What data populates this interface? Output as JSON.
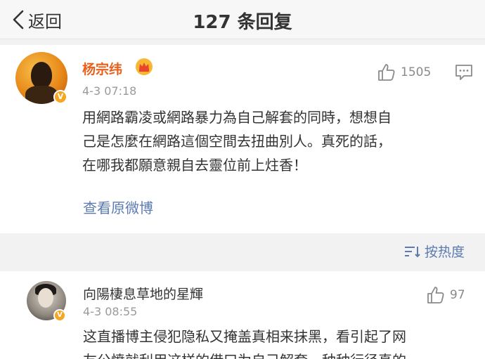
{
  "nav": {
    "back_label": "返回",
    "title": "127 条回复"
  },
  "main_comment": {
    "username": "杨宗纬",
    "time": "4-3 07:18",
    "likes": "1505",
    "text_lines": [
      "用網路霸凌或網路暴力為自己解套的同時，想想自",
      "己是怎麼在網路這個空間去扭曲別人。真死的話，",
      "在哪我都願意親自去靈位前上炷香！"
    ],
    "view_original": "查看原微博",
    "verified_badge": "V"
  },
  "sort": {
    "label": "按热度"
  },
  "reply": {
    "username": "向陽棲息草地的星輝",
    "time": "4-3 08:55",
    "likes": "97",
    "text_lines": [
      "这直播博主侵犯隐私又掩盖真相来抹黑，看引起了网",
      "友公愤就利用这样的借口为自己解套，种种行径真的"
    ],
    "verified_badge": "V"
  },
  "colors": {
    "accent_name": "#e8601b",
    "link": "#5b7bb2",
    "badge": "#f5a623"
  }
}
